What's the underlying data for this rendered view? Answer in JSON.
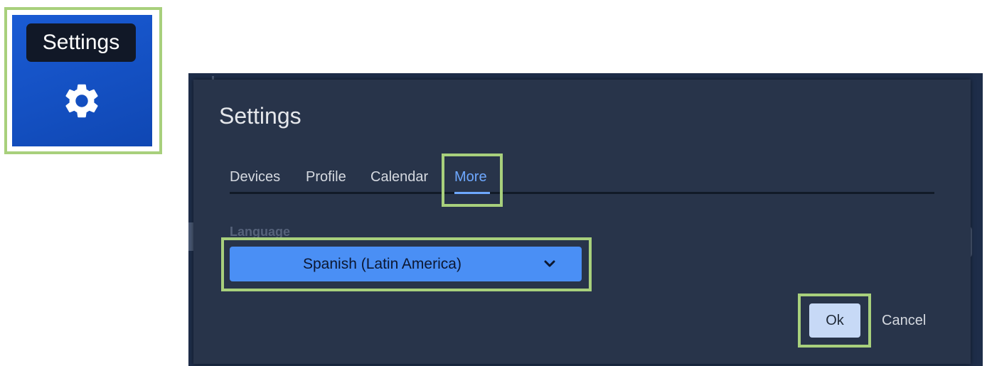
{
  "toolbar": {
    "settings_tooltip": "Settings",
    "settings_icon": "gear-icon",
    "button_color": "#1253c4"
  },
  "dialog": {
    "title": "Settings",
    "tabs": [
      {
        "label": "Devices",
        "active": false
      },
      {
        "label": "Profile",
        "active": false
      },
      {
        "label": "Calendar",
        "active": false
      },
      {
        "label": "More",
        "active": true
      }
    ],
    "language": {
      "label": "Language",
      "selected": "Spanish (Latin America)",
      "icon": "chevron-down-icon"
    },
    "ok_label": "Ok",
    "cancel_label": "Cancel"
  },
  "colors": {
    "highlight": "#a8d07c",
    "accent": "#6ea8ff",
    "dialog_bg": "#28344a",
    "select_bg": "#4a8ff5"
  }
}
